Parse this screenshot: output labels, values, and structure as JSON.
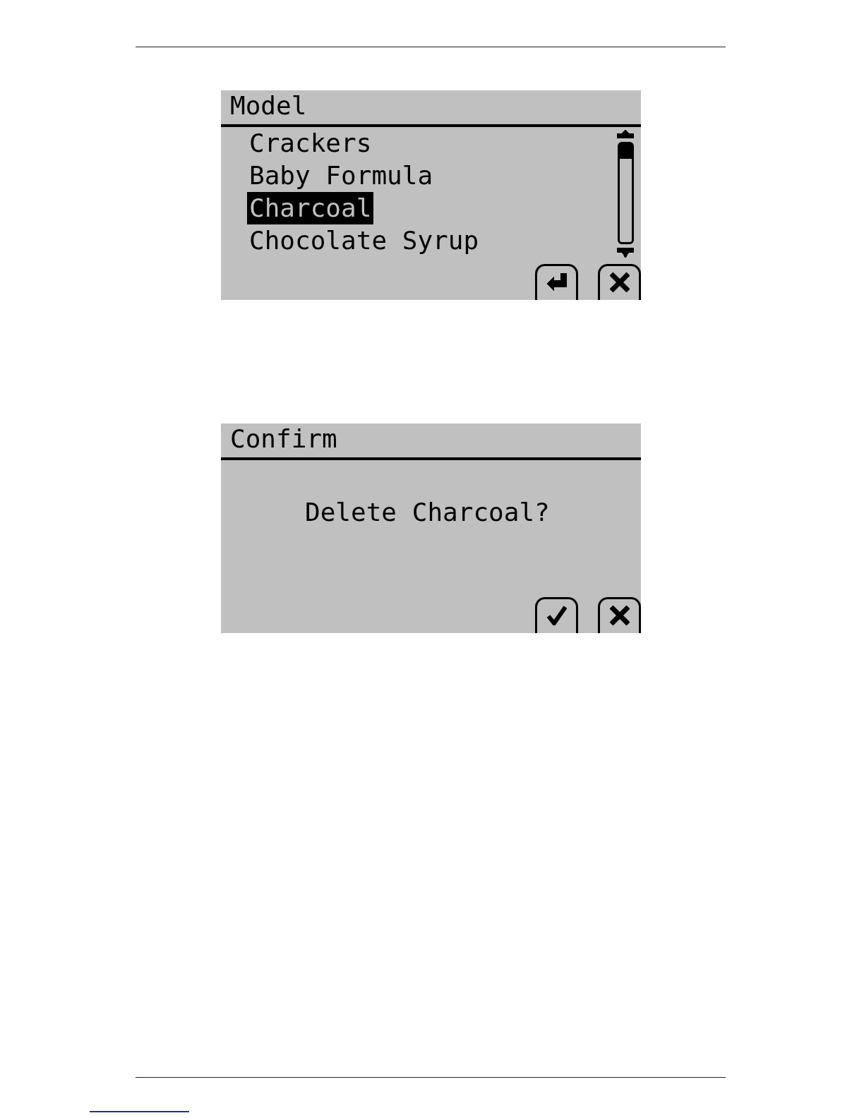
{
  "screens": [
    {
      "kind": "list",
      "title": "Model",
      "items": [
        {
          "label": "Crackers",
          "selected": false
        },
        {
          "label": "Baby Formula",
          "selected": false
        },
        {
          "label": "Charcoal",
          "selected": true
        },
        {
          "label": "Chocolate Syrup",
          "selected": false
        }
      ],
      "buttons": [
        {
          "kind": "enter"
        },
        {
          "kind": "cancel"
        }
      ]
    },
    {
      "kind": "message",
      "title": "Confirm",
      "message": "Delete Charcoal?",
      "buttons": [
        {
          "kind": "confirm"
        },
        {
          "kind": "cancel"
        }
      ]
    }
  ]
}
